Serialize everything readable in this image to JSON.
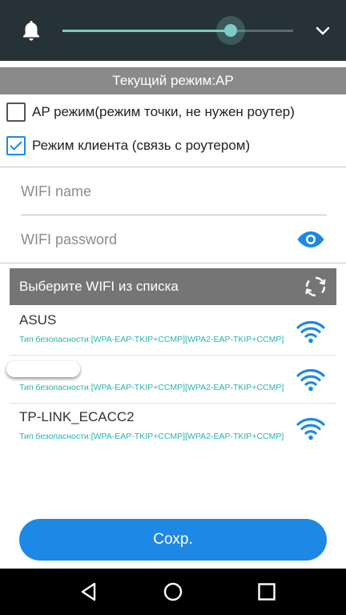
{
  "volume": {
    "level_fraction": 0.73,
    "accent": "#80cbc4"
  },
  "mode_bar": {
    "label": "Текущий режим:AP"
  },
  "options": [
    {
      "label": "AP режим(режим точки, не нужен роутер)",
      "checked": false
    },
    {
      "label": "Режим клиента (связь с роутером)",
      "checked": true
    }
  ],
  "fields": {
    "wifi_name_placeholder": "WIFI name",
    "wifi_password_placeholder": "WIFI password"
  },
  "list_header": {
    "title": "Выберите WIFI из списка"
  },
  "networks": [
    {
      "name": "ASUS",
      "security": "Тип безопасности:[WPA-EAP-TKIP+CCMP][WPA2-EAP-TKIP+CCMP]"
    },
    {
      "name": "",
      "security": "Тип безопасности:[WPA-EAP-TKIP+CCMP][WPA2-EAP-TKIP+CCMP]"
    },
    {
      "name": "TP-LINK_ECACC2",
      "security": "Тип безопасности:[WPA-EAP-TKIP+CCMP][WPA2-EAP-TKIP+CCMP]"
    }
  ],
  "save_button": {
    "label": "Сохр."
  },
  "colors": {
    "primary": "#1e88e5",
    "teal_text": "#26b3b3",
    "header_gray": "#757575"
  }
}
